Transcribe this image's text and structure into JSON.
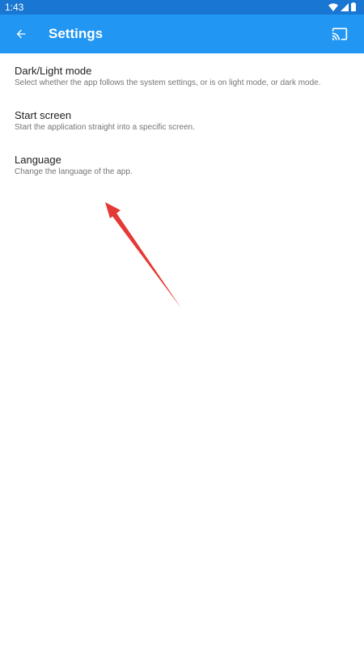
{
  "status_bar": {
    "time": "1:43",
    "icons": [
      "wifi-icon",
      "cellular-icon",
      "battery-icon"
    ]
  },
  "app_bar": {
    "title": "Settings",
    "back_icon": "arrow-back-icon",
    "cast_icon": "cast-icon",
    "color": "#2196f3",
    "status_color": "#1976d2"
  },
  "settings": {
    "items": [
      {
        "title": "Dark/Light mode",
        "description": "Select whether the app follows the system settings, or is on light mode, or dark mode."
      },
      {
        "title": "Start screen",
        "description": "Start the application straight into a specific screen."
      },
      {
        "title": "Language",
        "description": "Change the language of the app."
      }
    ]
  },
  "annotation": {
    "type": "arrow",
    "color": "#e53935",
    "points_to": "Language"
  }
}
